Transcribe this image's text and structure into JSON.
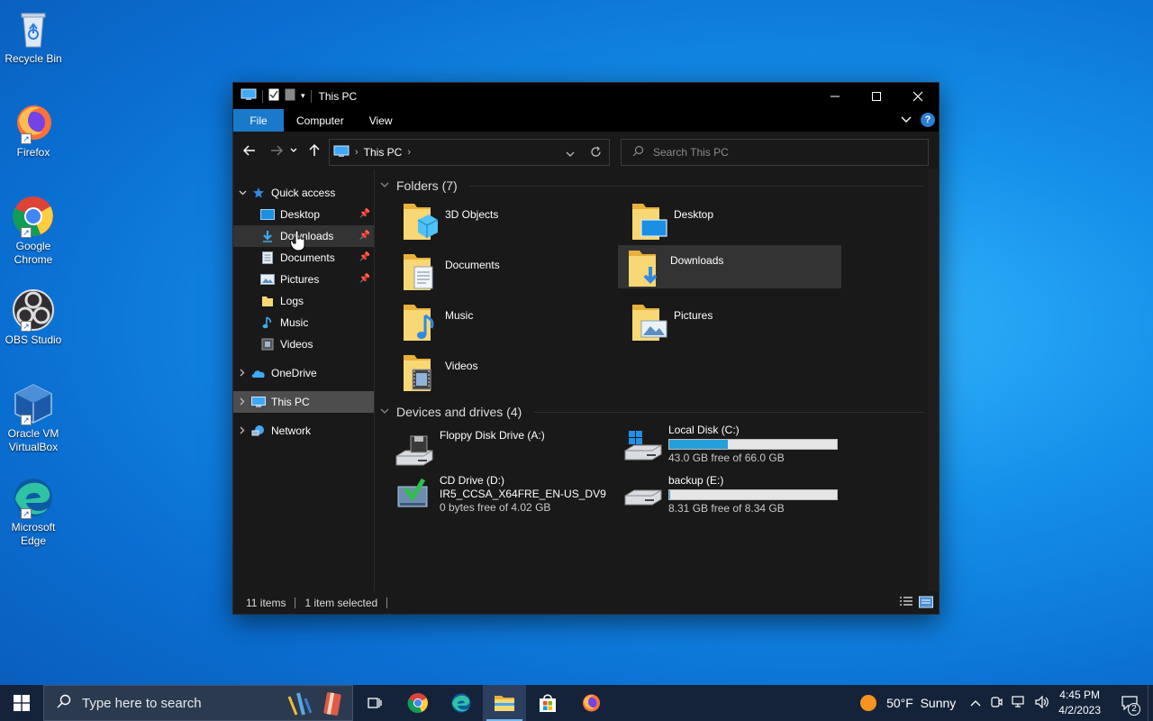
{
  "desktop": {
    "icons": [
      {
        "label": "Recycle Bin"
      },
      {
        "label": "Firefox"
      },
      {
        "label": "Google Chrome"
      },
      {
        "label": "OBS Studio"
      },
      {
        "label": "Oracle VM VirtualBox"
      },
      {
        "label": "Microsoft Edge"
      }
    ]
  },
  "window": {
    "title": "This PC",
    "ribbon_tabs": [
      "File",
      "Computer",
      "View"
    ],
    "address": {
      "path": "This PC"
    },
    "search": {
      "placeholder": "Search This PC"
    }
  },
  "navpane": {
    "quick_access": "Quick access",
    "quick_items": [
      {
        "label": "Desktop"
      },
      {
        "label": "Downloads"
      },
      {
        "label": "Documents"
      },
      {
        "label": "Pictures"
      },
      {
        "label": "Logs"
      },
      {
        "label": "Music"
      },
      {
        "label": "Videos"
      }
    ],
    "onedrive": "OneDrive",
    "this_pc": "This PC",
    "network": "Network"
  },
  "folders": {
    "header": "Folders (7)",
    "items": [
      {
        "name": "3D Objects"
      },
      {
        "name": "Desktop"
      },
      {
        "name": "Documents"
      },
      {
        "name": "Downloads"
      },
      {
        "name": "Music"
      },
      {
        "name": "Pictures"
      },
      {
        "name": "Videos"
      }
    ]
  },
  "drives": {
    "header": "Devices and drives (4)",
    "items": [
      {
        "name": "Floppy Disk Drive (A:)"
      },
      {
        "name": "Local Disk (C:)",
        "free": "43.0 GB free of 66.0 GB",
        "used_fraction": 0.35
      },
      {
        "name": "CD Drive (D:)",
        "label": "IR5_CCSA_X64FRE_EN-US_DV9",
        "free": "0 bytes free of 4.02 GB"
      },
      {
        "name": "backup (E:)",
        "free": "8.31 GB free of 8.34 GB",
        "used_fraction": 0.004
      }
    ]
  },
  "status": {
    "items": "11 items",
    "selected": "1 item selected"
  },
  "taskbar": {
    "search_placeholder": "Type here to search",
    "weather": "50°F  Sunny",
    "time": "4:45 PM",
    "date": "4/2/2023",
    "notifications": "2"
  },
  "colors": {
    "accent": "#1979ca",
    "capacity_fill": "#26a0da"
  }
}
